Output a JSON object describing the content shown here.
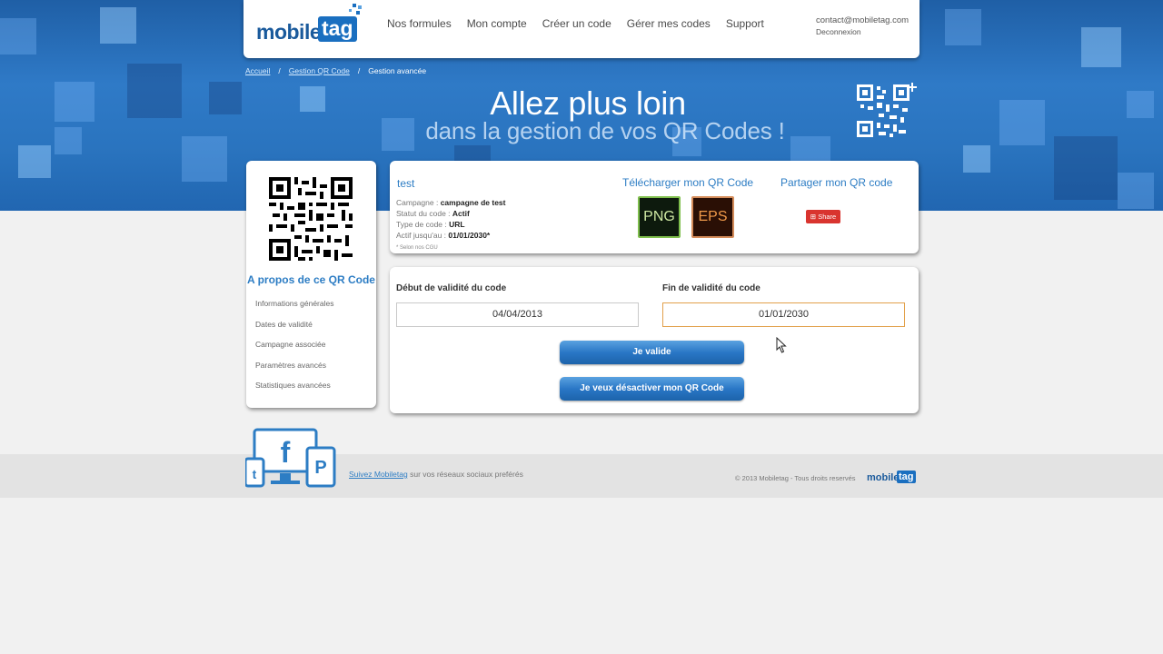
{
  "header": {
    "logo_word": "mobile",
    "logo_tag": "tag",
    "nav": [
      "Nos formules",
      "Mon compte",
      "Créer un code",
      "Gérer mes codes",
      "Support"
    ],
    "email": "contact@mobiletag.com",
    "logout": "Deconnexion"
  },
  "breadcrumb": {
    "home": "Accueil",
    "qr_management": "Gestion QR Code",
    "current": "Gestion avancée",
    "separator": "/"
  },
  "hero": {
    "title": "Allez plus loin",
    "subtitle": "dans la gestion de vos QR Codes !"
  },
  "sidebar": {
    "title": "A propos de ce QR Code",
    "items": [
      "Informations générales",
      "Dates de validité",
      "Campagne associée",
      "Paramètres avancés",
      "Statistiques avancées"
    ]
  },
  "code_info": {
    "name": "test",
    "campaign_label": "Campagne :",
    "campaign_value": "campagne de test",
    "status_label": "Statut du code :",
    "status_value": "Actif",
    "type_label": "Type de code :",
    "type_value": "URL",
    "active_until_label": "Actif jusqu'au :",
    "active_until_value": "01/01/2030*",
    "note": "* Selon nos CGU"
  },
  "download": {
    "title": "Télécharger mon QR Code",
    "png": "PNG",
    "eps": "EPS"
  },
  "share": {
    "title": "Partager mon QR code",
    "button": "Share"
  },
  "validity": {
    "start_label": "Début de validité du code",
    "start_value": "04/04/2013",
    "end_label": "Fin de validité du code",
    "end_value": "01/01/2030",
    "validate_button": "Je valide",
    "deactivate_button": "Je veux désactiver mon QR Code"
  },
  "footer": {
    "follow_link": "Suivez Mobiletag",
    "follow_text": " sur vos réseaux sociaux preférés",
    "copyright": "© 2013 Mobiletag - Tous droits reservés",
    "logo_word": "mobile",
    "logo_tag": "tag"
  },
  "colors": {
    "brand_blue": "#2d7dc4",
    "hero_blue": "#2a74bf",
    "share_red": "#d9342f",
    "focus_orange": "#e2a04a"
  }
}
